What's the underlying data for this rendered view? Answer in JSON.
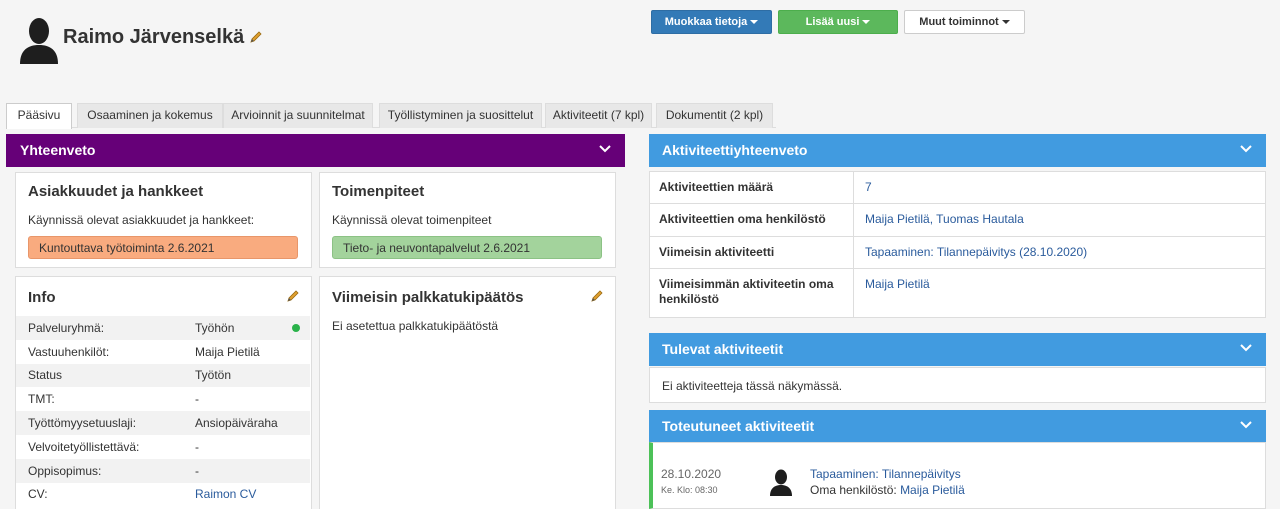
{
  "person": {
    "name": "Raimo Järvenselkä"
  },
  "actions": {
    "edit_label": "Muokkaa tietoja",
    "add_label": "Lisää uusi",
    "other_label": "Muut toiminnot"
  },
  "tabs": [
    {
      "label": "Pääsivu",
      "active": true
    },
    {
      "label": "Osaaminen ja kokemus"
    },
    {
      "label": "Arvioinnit ja suunnitelmat"
    },
    {
      "label": "Työllistyminen ja suosittelut"
    },
    {
      "label": "Aktiviteetit (7 kpl)"
    },
    {
      "label": "Dokumentit (2 kpl)"
    }
  ],
  "summary": {
    "title": "Yhteenveto",
    "customers": {
      "title": "Asiakkuudet ja hankkeet",
      "subtitle": "Käynnissä olevat asiakkuudet ja hankkeet:",
      "item": "Kuntouttava työtoiminta 2.6.2021"
    },
    "measures": {
      "title": "Toimenpiteet",
      "subtitle": "Käynnissä olevat toimenpiteet",
      "item": "Tieto- ja neuvontapalvelut 2.6.2021"
    },
    "info": {
      "title": "Info",
      "rows": [
        {
          "key": "Palveluryhmä:",
          "value": "Työhön"
        },
        {
          "key": "Vastuuhenkilöt:",
          "value": "Maija Pietilä"
        },
        {
          "key": "Status",
          "value": "Työtön"
        },
        {
          "key": "TMT:",
          "value": "-"
        },
        {
          "key": "Työttömyysetuuslaji:",
          "value": "Ansiopäiväraha"
        },
        {
          "key": "Velvoitetyöllistettävä:",
          "value": "-"
        },
        {
          "key": "Oppisopimus:",
          "value": "-"
        },
        {
          "key": "CV:",
          "value": "Raimon CV"
        }
      ]
    },
    "wage": {
      "title": "Viimeisin palkkatukipäätös",
      "text": "Ei asetettua palkkatukipäätöstä"
    }
  },
  "activity_summary": {
    "title": "Aktiviteettiyhteenveto",
    "rows": [
      {
        "key": "Aktiviteettien määrä",
        "value": "7"
      },
      {
        "key": "Aktiviteettien oma henkilöstö",
        "value": "Maija Pietilä, Tuomas Hautala"
      },
      {
        "key": "Viimeisin aktiviteetti",
        "value": "Tapaaminen: Tilannepäivitys (28.10.2020)"
      },
      {
        "key": "Viimeisimmän aktiviteetin oma henkilöstö",
        "value": "Maija Pietilä"
      }
    ]
  },
  "upcoming": {
    "title": "Tulevat aktiviteetit",
    "empty": "Ei aktiviteetteja tässä näkymässä."
  },
  "completed": {
    "title": "Toteutuneet aktiviteetit",
    "items": [
      {
        "date": "28.10.2020",
        "time": "Ke. Klo: 08:30",
        "title": "Tapaaminen: Tilannepäivitys",
        "staff_label": "Oma henkilöstö:",
        "staff": "Maija Pietilä"
      }
    ]
  },
  "icons": {
    "avatar": "person-silhouette-icon",
    "edit": "pencil-icon",
    "collapse": "chevron-down-icon"
  },
  "colors": {
    "purple": "#660078",
    "blue": "#419be0",
    "orange_pill": "#f9ab7f",
    "green_pill": "#a3d39c",
    "status_dot": "#2ab24a"
  }
}
